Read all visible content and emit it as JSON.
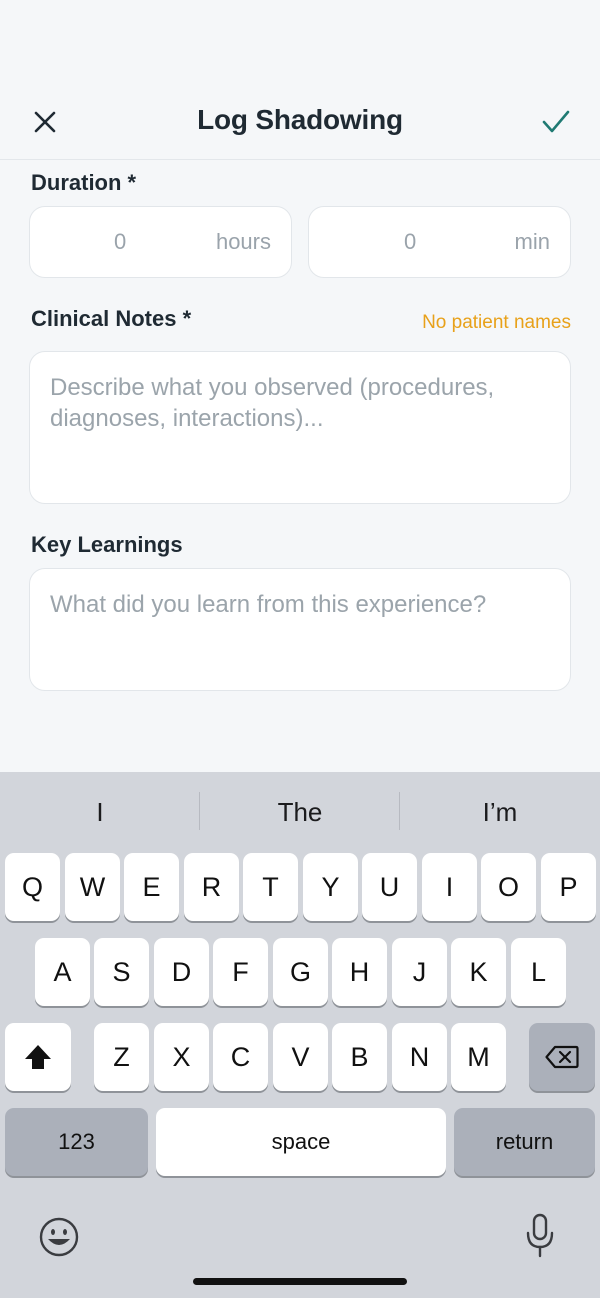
{
  "header": {
    "title": "Log Shadowing",
    "close_icon": "close-icon",
    "confirm_icon": "checkmark-icon",
    "accent_color": "#1f7a73"
  },
  "form": {
    "duration": {
      "label": "Duration *",
      "hours_value": "0",
      "hours_unit": "hours",
      "minutes_value": "0",
      "minutes_unit": "min"
    },
    "clinical_notes": {
      "label": "Clinical Notes *",
      "hint": "No patient names",
      "placeholder": "Describe what you observed (procedures, diagnoses, interactions)..."
    },
    "key_learnings": {
      "label": "Key Learnings",
      "placeholder": "What did you learn from this experience?"
    },
    "hint_color": "#e8a11a"
  },
  "keyboard": {
    "suggestions": [
      "I",
      "The",
      "I’m"
    ],
    "row1": [
      "Q",
      "W",
      "E",
      "R",
      "T",
      "Y",
      "U",
      "I",
      "O",
      "P"
    ],
    "row2": [
      "A",
      "S",
      "D",
      "F",
      "G",
      "H",
      "J",
      "K",
      "L"
    ],
    "row3": [
      "Z",
      "X",
      "C",
      "V",
      "B",
      "N",
      "M"
    ],
    "shift_icon": "shift-icon",
    "delete_icon": "backspace-icon",
    "numbers_label": "123",
    "space_label": "space",
    "return_label": "return",
    "emoji_icon": "emoji-icon",
    "mic_icon": "microphone-icon"
  }
}
